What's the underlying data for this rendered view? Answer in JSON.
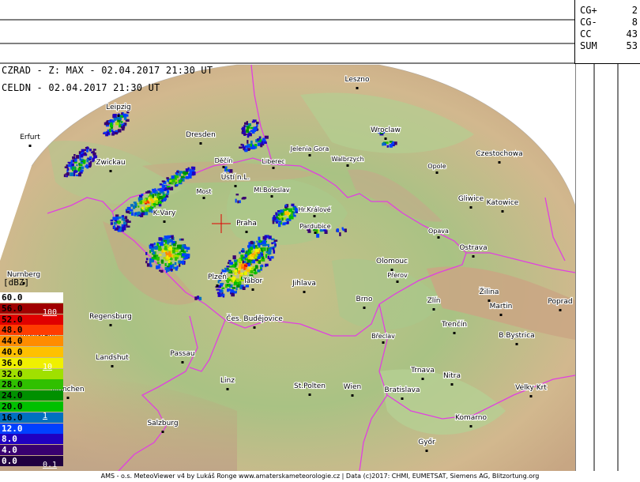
{
  "header": {
    "line1": "CZRAD - Z: MAX - 02.04.2017 21:30 UT",
    "line2": "CELDN - 02.04.2017 21:30 UT"
  },
  "lightning_counts": [
    {
      "label": "CG+",
      "value": "2"
    },
    {
      "label": "CG-",
      "value": "8"
    },
    {
      "label": "CC",
      "value": "43"
    },
    {
      "label": "SUM",
      "value": "53"
    }
  ],
  "legend": {
    "title": "[dBZ]",
    "unit": "mm/h",
    "levels": [
      {
        "dbz": "60.0",
        "color": "#ffffff",
        "text": "#000000"
      },
      {
        "dbz": "56.0",
        "color": "#a00000",
        "text": "#000000"
      },
      {
        "dbz": "52.0",
        "color": "#e00000",
        "text": "#000000"
      },
      {
        "dbz": "48.0",
        "color": "#ff3c00",
        "text": "#000000"
      },
      {
        "dbz": "44.0",
        "color": "#ff8c00",
        "text": "#000000"
      },
      {
        "dbz": "40.0",
        "color": "#ffc000",
        "text": "#000000"
      },
      {
        "dbz": "36.0",
        "color": "#f0f000",
        "text": "#000000"
      },
      {
        "dbz": "32.0",
        "color": "#a0e000",
        "text": "#000000"
      },
      {
        "dbz": "28.0",
        "color": "#30c000",
        "text": "#000000"
      },
      {
        "dbz": "24.0",
        "color": "#009000",
        "text": "#000000"
      },
      {
        "dbz": "20.0",
        "color": "#00c000",
        "text": "#000000"
      },
      {
        "dbz": "16.0",
        "color": "#0070c0",
        "text": "#000000"
      },
      {
        "dbz": "12.0",
        "color": "#0040ff",
        "text": "#ffffff"
      },
      {
        "dbz": "8.0",
        "color": "#2000c0",
        "text": "#ffffff"
      },
      {
        "dbz": "4.0",
        "color": "#380070",
        "text": "#ffffff"
      },
      {
        "dbz": "0.0",
        "color": "#200040",
        "text": "#ffffff"
      }
    ],
    "rates": [
      {
        "label": "100",
        "level_index": 1.5
      },
      {
        "label": "10",
        "level_index": 6.5
      },
      {
        "label": "1",
        "level_index": 11
      },
      {
        "label": "0.1",
        "level_index": 15.5
      }
    ]
  },
  "cities": [
    {
      "name": "Leszno"
    },
    {
      "name": "Leipzig"
    },
    {
      "name": "Wroclaw"
    },
    {
      "name": "Erfurt"
    },
    {
      "name": "Dresden"
    },
    {
      "name": "Jelenia Gora"
    },
    {
      "name": "Walbrzych"
    },
    {
      "name": "Czestochowa"
    },
    {
      "name": "Zwickau"
    },
    {
      "name": "Děčín"
    },
    {
      "name": "Liberec"
    },
    {
      "name": "Opole"
    },
    {
      "name": "Ústí n.L."
    },
    {
      "name": "Most"
    },
    {
      "name": "Ml.Boleslav"
    },
    {
      "name": "Gliwice"
    },
    {
      "name": "Katowice"
    },
    {
      "name": "K.Vary"
    },
    {
      "name": "Hr.Králové"
    },
    {
      "name": "Praha"
    },
    {
      "name": "Pardubice"
    },
    {
      "name": "Opava"
    },
    {
      "name": "Ostrava"
    },
    {
      "name": "Olomouc"
    },
    {
      "name": "Nurnberg"
    },
    {
      "name": "Plzeň"
    },
    {
      "name": "Tábor"
    },
    {
      "name": "Jihlava"
    },
    {
      "name": "Přerov"
    },
    {
      "name": "Žilina"
    },
    {
      "name": "Brno"
    },
    {
      "name": "Zlín"
    },
    {
      "name": "Martin"
    },
    {
      "name": "Poprad"
    },
    {
      "name": "Regensburg"
    },
    {
      "name": "Čes. Budějovice"
    },
    {
      "name": "Trenčín"
    },
    {
      "name": "Ingolstadt"
    },
    {
      "name": "Břeclav"
    },
    {
      "name": "B.Bystrica"
    },
    {
      "name": "Landshut"
    },
    {
      "name": "Passau"
    },
    {
      "name": "Trnava"
    },
    {
      "name": "Nitra"
    },
    {
      "name": "Linz"
    },
    {
      "name": "Munchen"
    },
    {
      "name": "St.Polten"
    },
    {
      "name": "Wien"
    },
    {
      "name": "Bratislava"
    },
    {
      "name": "Velky Krt"
    },
    {
      "name": "Salzburg"
    },
    {
      "name": "Komarno"
    },
    {
      "name": "Győr"
    }
  ],
  "footer": "AMS - o.s. MeteoViewer v4 by Lukáš Ronge www.amaterskameteorologie.cz | Data (c)2017: CHMI, EUMETSAT, Siemens AG, Blitzortung.org",
  "colors": {
    "border": "#e040e0",
    "terrain_low": "#8fb87a",
    "terrain_high": "#d9b48a",
    "radar_center": "#e00000"
  },
  "icons": {
    "radar_site": "red-crosshair-icon"
  }
}
